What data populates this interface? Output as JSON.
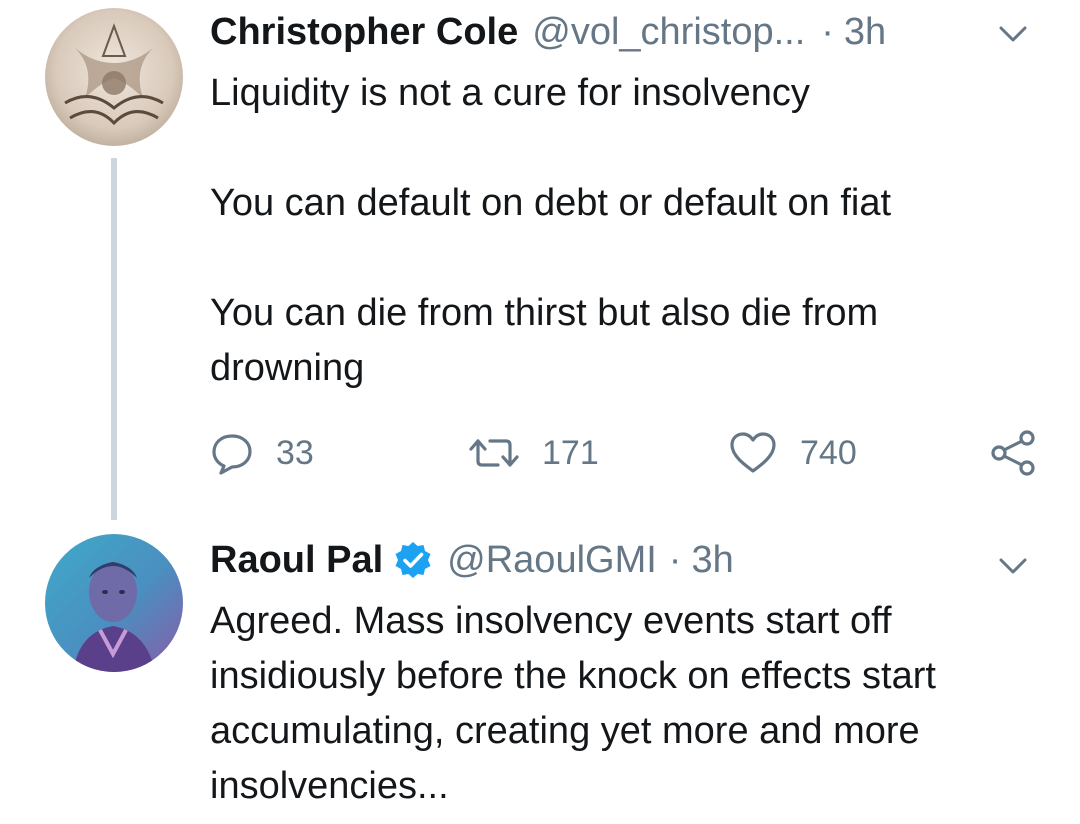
{
  "tweets": [
    {
      "author_name": "Christopher Cole",
      "handle": "@vol_christop...",
      "separator": "·",
      "time": "3h",
      "avatar_icon": "engraving-avatar-icon",
      "verified": false,
      "paragraphs": [
        "Liquidity is not a cure for insolvency",
        "You can default on debt or default on fiat",
        "You can die from thirst but also die from drowning"
      ],
      "actions": {
        "reply_count": "33",
        "retweet_count": "171",
        "like_count": "740"
      }
    },
    {
      "author_name": "Raoul Pal",
      "handle": "@RaoulGMI",
      "separator": "·",
      "time": "3h",
      "avatar_icon": "portrait-avatar-icon",
      "verified": true,
      "paragraphs": [
        "Agreed. Mass insolvency events start off insidiously before the knock on effects start accumulating, creating yet more and more insolvencies..."
      ]
    }
  ],
  "colors": {
    "text": "#14171a",
    "secondary": "#657786",
    "thread_line": "#cdd6dd",
    "verified_blue": "#1da1f2"
  }
}
